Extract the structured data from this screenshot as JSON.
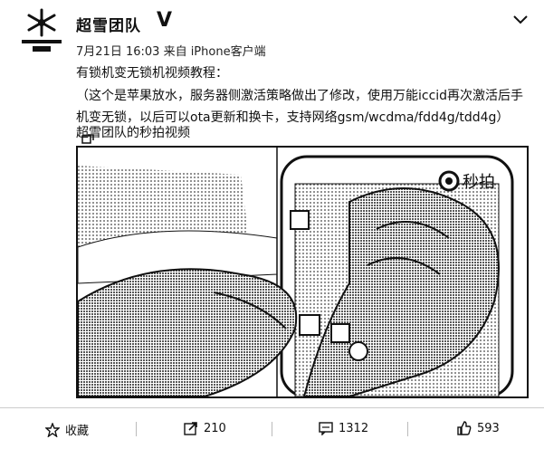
{
  "post": {
    "author": "超雪团队",
    "verified_badge": "V",
    "timestamp": "7月21日 16:03",
    "source": "来自 iPhone客户端",
    "line1": "有锁机变无锁机视频教程：",
    "paragraph": "（这个是苹果放水，服务器侧激活策略做出了修改，使用万能iccid再次激活后手机变无锁，以后可以ota更新和换卡，支持网络gsm/wcdma/fdd4g/tdd4g）",
    "video_label": "超雪团队的秒拍视频",
    "video_watermark": "秒拍"
  },
  "actions": {
    "favorite": {
      "label": "收藏",
      "icon": "star-icon"
    },
    "repost": {
      "count": "210",
      "icon": "repost-icon"
    },
    "comment": {
      "count": "1312",
      "icon": "comment-icon"
    },
    "like": {
      "count": "593",
      "icon": "thumbs-up-icon"
    }
  },
  "colors": {
    "text": "#111111",
    "divider": "#cccccc",
    "background": "#ffffff"
  }
}
